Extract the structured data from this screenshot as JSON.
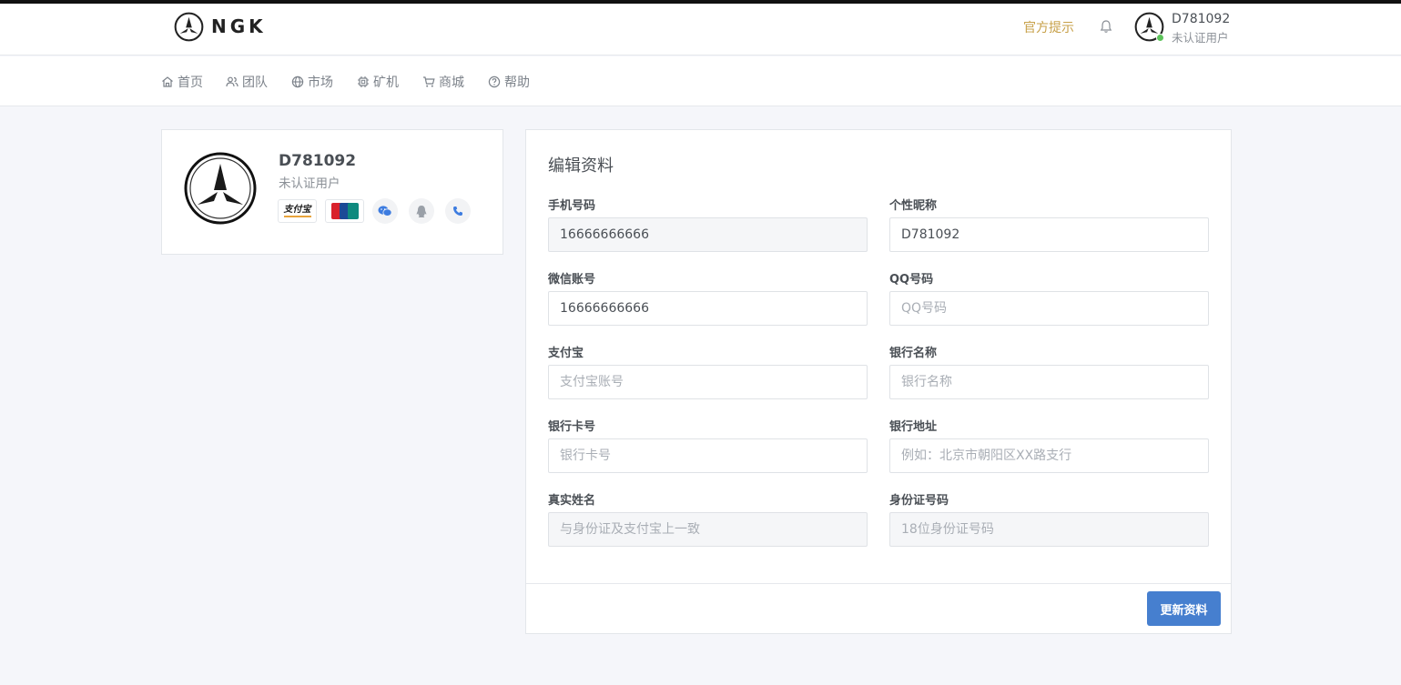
{
  "header": {
    "brand": "NGK",
    "notice_label": "官方提示",
    "user_name": "D781092",
    "user_status": "未认证用户"
  },
  "nav": {
    "items": [
      {
        "label": "首页",
        "icon": "home-icon"
      },
      {
        "label": "团队",
        "icon": "users-icon"
      },
      {
        "label": "市场",
        "icon": "globe-icon"
      },
      {
        "label": "矿机",
        "icon": "cpu-icon"
      },
      {
        "label": "商城",
        "icon": "cart-icon"
      },
      {
        "label": "帮助",
        "icon": "help-icon"
      }
    ]
  },
  "profile": {
    "name": "D781092",
    "status": "未认证用户",
    "alipay_label": "支付宝",
    "unionpay_label": "UnionPay 银联"
  },
  "form": {
    "title": "编辑资料",
    "fields": {
      "phone": {
        "label": "手机号码",
        "value": "16666666666",
        "placeholder": ""
      },
      "nickname": {
        "label": "个性昵称",
        "value": "D781092",
        "placeholder": ""
      },
      "wechat": {
        "label": "微信账号",
        "value": "16666666666",
        "placeholder": ""
      },
      "qq": {
        "label": "QQ号码",
        "value": "",
        "placeholder": "QQ号码"
      },
      "alipay": {
        "label": "支付宝",
        "value": "",
        "placeholder": "支付宝账号"
      },
      "bank_name": {
        "label": "银行名称",
        "value": "",
        "placeholder": "银行名称"
      },
      "bank_card": {
        "label": "银行卡号",
        "value": "",
        "placeholder": "银行卡号"
      },
      "bank_address": {
        "label": "银行地址",
        "value": "",
        "placeholder": "例如：北京市朝阳区XX路支行"
      },
      "real_name": {
        "label": "真实姓名",
        "value": "",
        "placeholder": "与身份证及支付宝上一致"
      },
      "id_number": {
        "label": "身份证号码",
        "value": "",
        "placeholder": "18位身份证号码"
      }
    },
    "submit_label": "更新资料"
  },
  "colors": {
    "accent": "#467fcf",
    "notice": "#c7a048",
    "online": "#5cc35a"
  }
}
